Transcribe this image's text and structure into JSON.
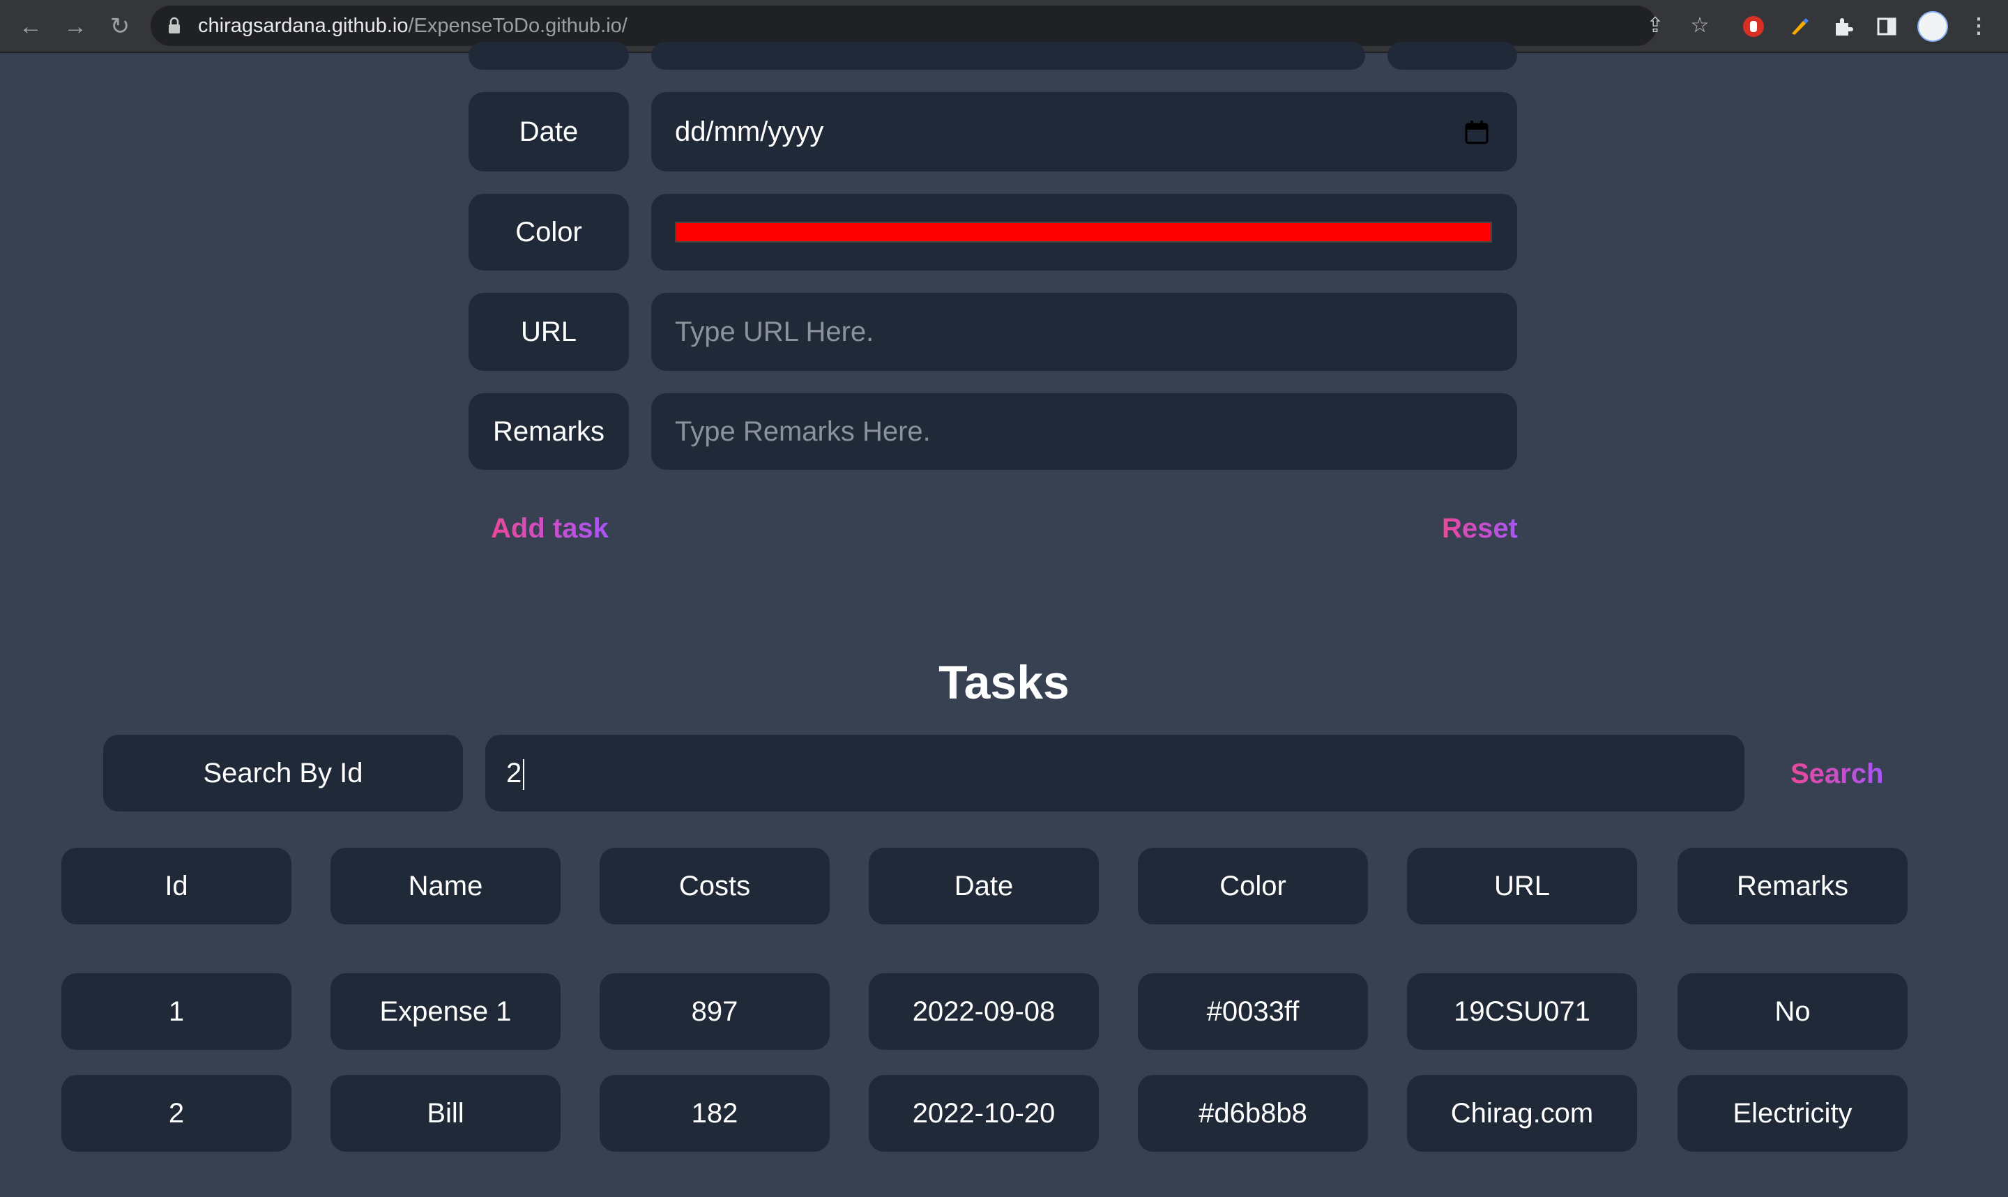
{
  "browser": {
    "url_host": "chiragsardana.github.io",
    "url_path": "/ExpenseToDo.github.io/"
  },
  "form": {
    "date": {
      "label": "Date",
      "placeholder": "dd/mm/yyyy"
    },
    "color": {
      "label": "Color",
      "value": "#ff0000"
    },
    "url": {
      "label": "URL",
      "placeholder": "Type URL Here."
    },
    "remarks": {
      "label": "Remarks",
      "placeholder": "Type Remarks Here."
    },
    "add_label": "Add task",
    "reset_label": "Reset"
  },
  "tasks": {
    "heading": "Tasks",
    "search_label": "Search By Id",
    "search_value": "2",
    "search_button": "Search",
    "columns": [
      "Id",
      "Name",
      "Costs",
      "Date",
      "Color",
      "URL",
      "Remarks"
    ],
    "rows": [
      [
        "1",
        "Expense 1",
        "897",
        "2022-09-08",
        "#0033ff",
        "19CSU071",
        "No"
      ],
      [
        "2",
        "Bill",
        "182",
        "2022-10-20",
        "#d6b8b8",
        "Chirag.com",
        "Electricity"
      ]
    ]
  },
  "colors": {
    "page_bg": "#374151",
    "pill_bg": "#1f2937",
    "accent_start": "#ec4899",
    "accent_end": "#a855f7"
  },
  "icons": [
    "back-icon",
    "forward-icon",
    "reload-icon",
    "lock-icon",
    "share-icon",
    "star-icon",
    "extension-icon",
    "puzzle-icon",
    "sidebar-icon",
    "menu-icon",
    "calendar-icon"
  ]
}
